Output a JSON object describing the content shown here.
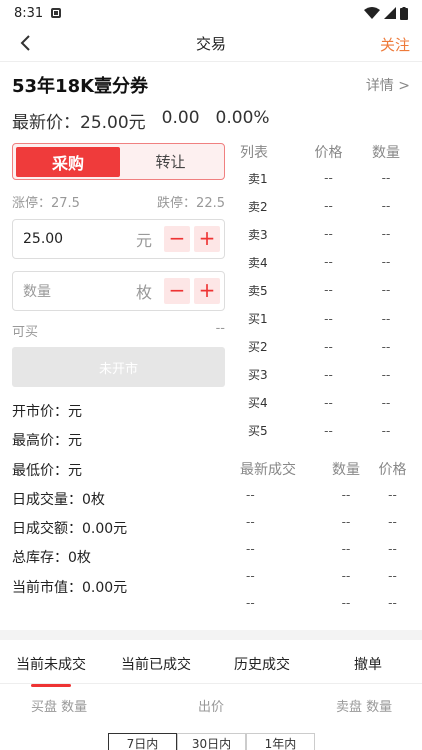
{
  "status_bar": {
    "time": "8:31"
  },
  "nav": {
    "title": "交易",
    "follow_label": "关注"
  },
  "product": {
    "name": "53年18K壹分券",
    "detail_label": "详情 >",
    "latest_price_label": "最新价：25.00元",
    "change_amount": "0.00",
    "change_percent": "0.00%"
  },
  "trade_form": {
    "tab_buy": "采购",
    "tab_transfer": "转让",
    "limit_up": "涨停：27.5",
    "limit_down": "跌停：22.5",
    "price_value": "25.00",
    "price_unit": "元",
    "quantity_placeholder": "数量",
    "quantity_unit": "枚",
    "can_buy_label": "可买",
    "can_buy_value": "--",
    "submit_label": "未开市"
  },
  "stats": [
    "开市价：元",
    "最高价：元",
    "最低价：元",
    "日成交量：0枚",
    "日成交额：0.00元",
    "总库存：0枚",
    "当前市值：0.00元"
  ],
  "order_book": {
    "headers": [
      "列表",
      "价格",
      "数量"
    ],
    "rows": [
      [
        "卖1",
        "--",
        "--"
      ],
      [
        "卖2",
        "--",
        "--"
      ],
      [
        "卖3",
        "--",
        "--"
      ],
      [
        "卖4",
        "--",
        "--"
      ],
      [
        "卖5",
        "--",
        "--"
      ],
      [
        "买1",
        "--",
        "--"
      ],
      [
        "买2",
        "--",
        "--"
      ],
      [
        "买3",
        "--",
        "--"
      ],
      [
        "买4",
        "--",
        "--"
      ],
      [
        "买5",
        "--",
        "--"
      ]
    ]
  },
  "latest_trades": {
    "headers": [
      "最新成交",
      "数量",
      "价格"
    ],
    "rows": [
      [
        "--",
        "--",
        "--"
      ],
      [
        "--",
        "--",
        "--"
      ],
      [
        "--",
        "--",
        "--"
      ],
      [
        "--",
        "--",
        "--"
      ],
      [
        "--",
        "--",
        "--"
      ]
    ]
  },
  "order_tabs": [
    "当前未成交",
    "当前已成交",
    "历史成交",
    "撤单"
  ],
  "order_header": {
    "buy": "买盘 数量",
    "price": "出价",
    "sell": "卖盘 数量"
  },
  "ranges": [
    "7日内",
    "30日内",
    "1年内"
  ],
  "colors": {
    "accent_red": "#ef3b3b",
    "follow_orange": "#ee7a3a"
  }
}
